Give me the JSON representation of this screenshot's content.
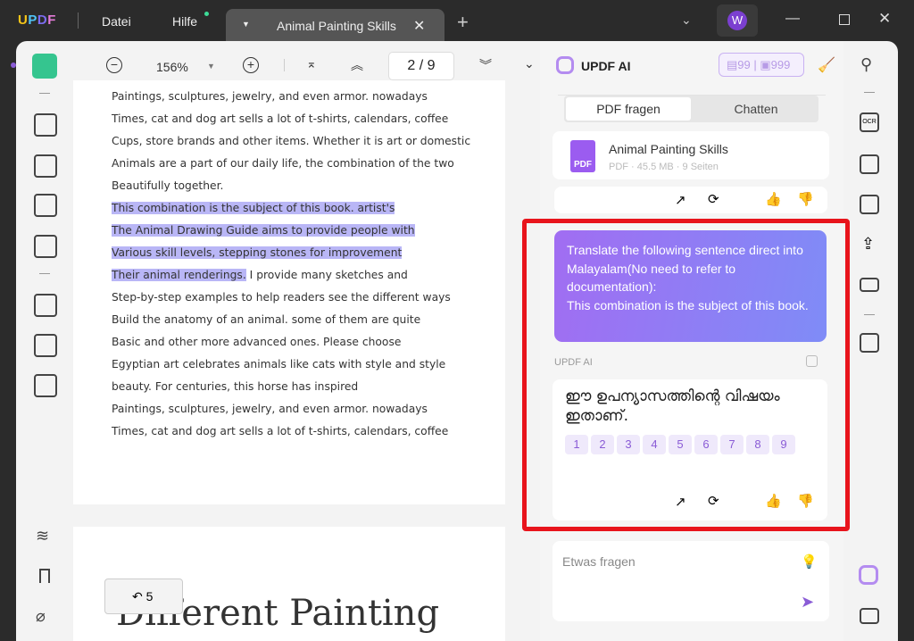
{
  "titlebar": {
    "logo": "UPDF",
    "menu": [
      "Datei",
      "Hilfe"
    ],
    "tab_title": "Animal Painting Skills",
    "avatar": "W"
  },
  "toolbar": {
    "zoom": "156%",
    "page": "2 / 9"
  },
  "document": {
    "lines_before": [
      "Paintings, sculptures, jewelry, and even armor. nowadays",
      "Times, cat and dog art sells a lot of t-shirts, calendars, coffee",
      "Cups, store brands and other items. Whether it is art or domestic",
      "Animals are a part of our daily life, the combination of the two",
      "Beautifully together."
    ],
    "highlighted": [
      "This combination is the subject of this book. artist's",
      "The Animal Drawing Guide aims to provide people with",
      "Various skill levels, stepping stones for improvement",
      "Their animal renderings."
    ],
    "line_after_highlight": " I provide many sketches and",
    "lines_after": [
      "Step-by-step examples to help readers see the different ways",
      "Build the anatomy of an animal. some of them are quite",
      "Basic and other more advanced ones. Please choose",
      "Egyptian art celebrates animals like cats with style and style",
      "beauty. For centuries, this horse has inspired",
      "Paintings, sculptures, jewelry, and even armor. nowadays",
      "Times, cat and dog art sells a lot of t-shirts, calendars, coffee"
    ],
    "page2_heading": "Different Painting",
    "back_count": "5"
  },
  "ai": {
    "title": "UPDF AI",
    "credits_pdf": "99",
    "credits_chat": "999",
    "tabs": [
      "PDF fragen",
      "Chatten"
    ],
    "file": {
      "name": "Animal Painting Skills",
      "meta": "PDF · 45.5 MB · 9 Seiten",
      "icon_label": "PDF"
    },
    "user_message": "Translate the following sentence direct into Malayalam(No need to refer to documentation):\nThis combination is the subject of this book.",
    "assistant_label": "UPDF AI",
    "answer": "ഈ ഉപന്യാസത്തിന്റെ വിഷയം ഇതാണ്.",
    "refs": [
      "1",
      "2",
      "3",
      "4",
      "5",
      "6",
      "7",
      "8",
      "9"
    ],
    "input_placeholder": "Etwas fragen"
  },
  "colors": {
    "accent": "#8a5cd6",
    "highlight": "#b9b6f6",
    "annotation": "#e8141c"
  }
}
